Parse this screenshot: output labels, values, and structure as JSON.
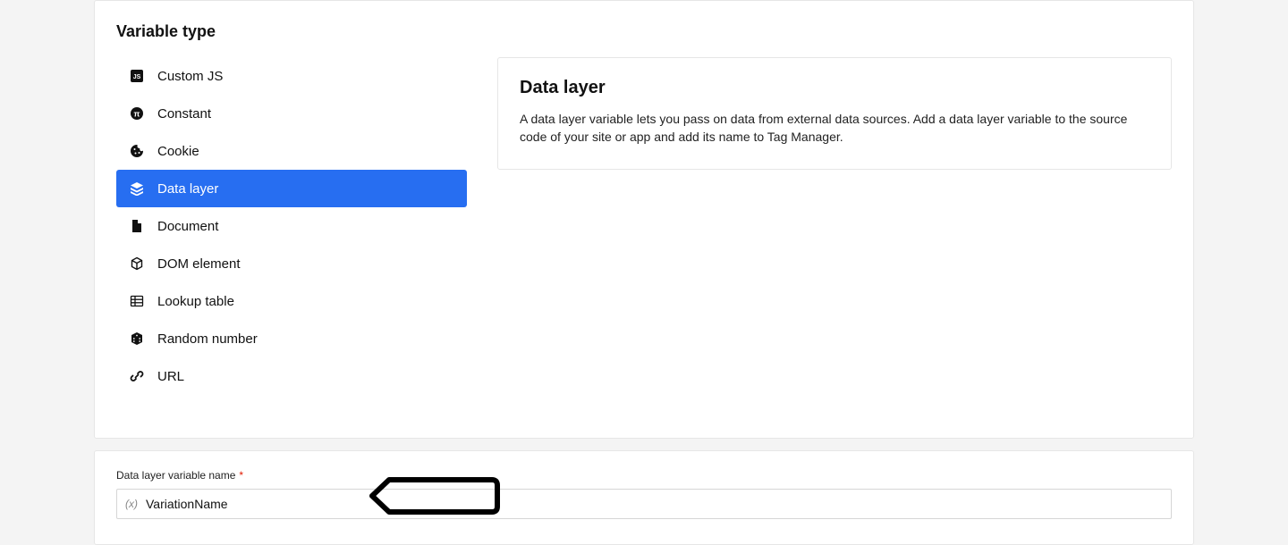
{
  "section": {
    "title": "Variable type",
    "types": [
      {
        "label": "Custom JS",
        "icon": "js"
      },
      {
        "label": "Constant",
        "icon": "constant"
      },
      {
        "label": "Cookie",
        "icon": "cookie"
      },
      {
        "label": "Data layer",
        "icon": "layers"
      },
      {
        "label": "Document",
        "icon": "document"
      },
      {
        "label": "DOM element",
        "icon": "cube-outline"
      },
      {
        "label": "Lookup table",
        "icon": "table"
      },
      {
        "label": "Random number",
        "icon": "dice"
      },
      {
        "label": "URL",
        "icon": "link"
      }
    ],
    "selected_index": 3,
    "info": {
      "title": "Data layer",
      "description": "A data layer variable lets you pass on data from external data sources. Add a data layer variable to the source code of your site or app and add its name to Tag Manager."
    }
  },
  "field": {
    "label": "Data layer variable name",
    "required_marker": "*",
    "value": "VariationName",
    "icon_glyph": "(x)"
  }
}
